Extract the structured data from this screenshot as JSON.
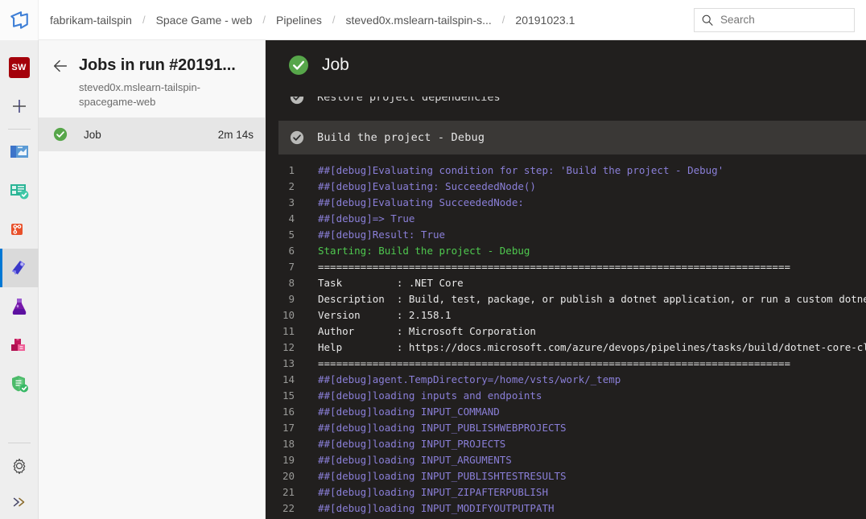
{
  "topbar": {
    "logo": "azure-devops-logo",
    "breadcrumbs": [
      {
        "label": "fabrikam-tailspin"
      },
      {
        "label": "Space Game - web"
      },
      {
        "label": "Pipelines"
      },
      {
        "label": "steved0x.mslearn-tailspin-s..."
      },
      {
        "label": "20191023.1"
      }
    ],
    "separator": "/",
    "search": {
      "placeholder": "Search",
      "value": "",
      "icon": "search-icon"
    }
  },
  "rail": {
    "items": [
      {
        "name": "project-avatar",
        "label": "SW",
        "icon": "project-avatar"
      },
      {
        "name": "new-item",
        "label": "+",
        "icon": "plus-icon"
      },
      {
        "name": "overview",
        "label": "Overview",
        "icon": "overview-icon"
      },
      {
        "name": "boards",
        "label": "Boards",
        "icon": "boards-icon"
      },
      {
        "name": "repos",
        "label": "Repos",
        "icon": "repos-icon"
      },
      {
        "name": "pipelines",
        "label": "Pipelines",
        "icon": "pipelines-icon",
        "selected": true
      },
      {
        "name": "test-plans",
        "label": "Test Plans",
        "icon": "test-plans-icon"
      },
      {
        "name": "artifacts",
        "label": "Artifacts",
        "icon": "artifacts-icon"
      },
      {
        "name": "security",
        "label": "Security",
        "icon": "shield-check-icon"
      },
      {
        "name": "settings",
        "label": "Project settings",
        "icon": "gear-icon"
      },
      {
        "name": "expand",
        "label": "Expand",
        "icon": "chevron-double-right-icon"
      }
    ]
  },
  "jobs_panel": {
    "back_icon": "back-arrow-icon",
    "title": "Jobs in run #20191...",
    "subtitle": "steved0x.mslearn-tailspin-spacegame-web",
    "job": {
      "status_icon": "success-check-icon",
      "name": "Job",
      "duration": "2m 14s"
    }
  },
  "console": {
    "header": {
      "status_icon": "success-check-icon",
      "title": "Job"
    },
    "clipped_step": {
      "status_icon": "success-check-icon-grey",
      "label": "Restore project dependencies"
    },
    "current_step": {
      "status_icon": "success-check-icon-grey",
      "label": "Build the project - Debug"
    },
    "colors": {
      "background": "#211f1e",
      "step_header_bg": "#3a3836",
      "debug_text": "#8a7fd8",
      "green_text": "#4fc84f",
      "normal_text": "#e8e8e8",
      "line_number": "#9a9a98",
      "accent": "#0078d4",
      "success_green": "#5db85c"
    },
    "log_lines": [
      {
        "n": "1",
        "text": "##[debug]Evaluating condition for step: 'Build the project - Debug'",
        "color": "debug"
      },
      {
        "n": "2",
        "text": "##[debug]Evaluating: SucceededNode()",
        "color": "debug"
      },
      {
        "n": "3",
        "text": "##[debug]Evaluating SucceededNode:",
        "color": "debug"
      },
      {
        "n": "4",
        "text": "##[debug]=> True",
        "color": "debug"
      },
      {
        "n": "5",
        "text": "##[debug]Result: True",
        "color": "debug"
      },
      {
        "n": "6",
        "text": "Starting: Build the project - Debug",
        "color": "green"
      },
      {
        "n": "7",
        "text": "==============================================================================",
        "color": "white"
      },
      {
        "n": "8",
        "text": "Task         : .NET Core",
        "color": "white"
      },
      {
        "n": "9",
        "text": "Description  : Build, test, package, or publish a dotnet application, or run a custom dotnet command",
        "color": "white"
      },
      {
        "n": "10",
        "text": "Version      : 2.158.1",
        "color": "white"
      },
      {
        "n": "11",
        "text": "Author       : Microsoft Corporation",
        "color": "white"
      },
      {
        "n": "12",
        "text": "Help         : https://docs.microsoft.com/azure/devops/pipelines/tasks/build/dotnet-core-cli",
        "color": "white"
      },
      {
        "n": "13",
        "text": "==============================================================================",
        "color": "white"
      },
      {
        "n": "14",
        "text": "##[debug]agent.TempDirectory=/home/vsts/work/_temp",
        "color": "debug"
      },
      {
        "n": "15",
        "text": "##[debug]loading inputs and endpoints",
        "color": "debug"
      },
      {
        "n": "16",
        "text": "##[debug]loading INPUT_COMMAND",
        "color": "debug"
      },
      {
        "n": "17",
        "text": "##[debug]loading INPUT_PUBLISHWEBPROJECTS",
        "color": "debug"
      },
      {
        "n": "18",
        "text": "##[debug]loading INPUT_PROJECTS",
        "color": "debug"
      },
      {
        "n": "19",
        "text": "##[debug]loading INPUT_ARGUMENTS",
        "color": "debug"
      },
      {
        "n": "20",
        "text": "##[debug]loading INPUT_PUBLISHTESTRESULTS",
        "color": "debug"
      },
      {
        "n": "21",
        "text": "##[debug]loading INPUT_ZIPAFTERPUBLISH",
        "color": "debug"
      },
      {
        "n": "22",
        "text": "##[debug]loading INPUT_MODIFYOUTPUTPATH",
        "color": "debug"
      }
    ]
  }
}
